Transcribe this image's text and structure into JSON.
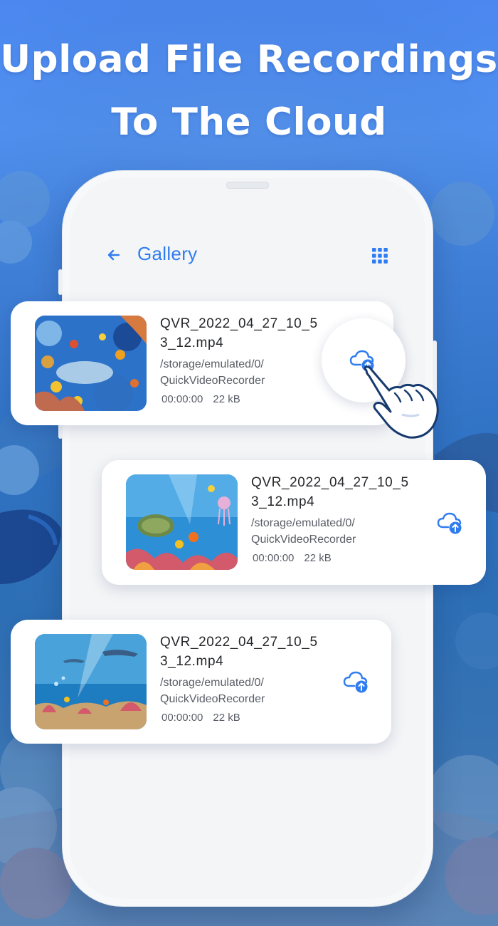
{
  "headline": {
    "line1": "Upload File Recordings",
    "line2": "To The Cloud"
  },
  "header": {
    "back_icon": "arrow-left-icon",
    "title": "Gallery",
    "view_toggle_icon": "grid-icon"
  },
  "files": [
    {
      "name": "QVR_2022_04_27_10_53_12.mp4",
      "path_line1": "/storage/emulated/0/",
      "path_line2": "QuickVideoRecorder",
      "duration": "00:00:00",
      "size": "22 kB",
      "action_icon": "cloud-upload-icon"
    },
    {
      "name": "QVR_2022_04_27_10_53_12.mp4",
      "path_line1": "/storage/emulated/0/",
      "path_line2": "QuickVideoRecorder",
      "duration": "00:00:00",
      "size": "22 kB",
      "action_icon": "cloud-upload-icon"
    },
    {
      "name": "QVR_2022_04_27_10_53_12.mp4",
      "path_line1": "/storage/emulated/0/",
      "path_line2": "QuickVideoRecorder",
      "duration": "00:00:00",
      "size": "22 kB",
      "action_icon": "cloud-upload-icon"
    }
  ],
  "colors": {
    "accent": "#2f7cf0",
    "background": "#4b87ef",
    "card": "#ffffff",
    "text_primary": "#26272b",
    "text_secondary": "#595d66"
  }
}
